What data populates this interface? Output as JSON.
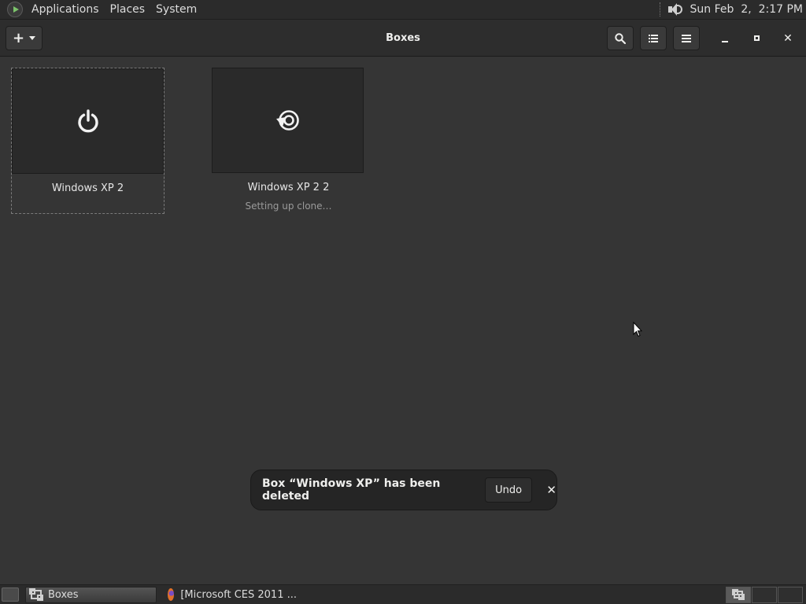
{
  "top_panel": {
    "menus": [
      "Applications",
      "Places",
      "System"
    ],
    "clock": "Sun Feb  2,  2:17 PM"
  },
  "header": {
    "title": "Boxes",
    "new_label": "+",
    "icons": [
      "search-icon",
      "list-view-icon",
      "hamburger-menu-icon"
    ]
  },
  "boxes": [
    {
      "name": "Windows XP 2",
      "status": "",
      "icon": "power-icon",
      "selected": true
    },
    {
      "name": "Windows XP 2 2",
      "status": "Setting up clone…",
      "icon": "restore-icon",
      "selected": false
    }
  ],
  "notification": {
    "message": "Box “Windows XP” has been deleted",
    "undo_label": "Undo",
    "close_label": "✕"
  },
  "taskbar": {
    "tasks": [
      {
        "label": "Boxes",
        "active": true
      },
      {
        "label": "[Microsoft CES 2011 ...",
        "active": false
      }
    ]
  }
}
